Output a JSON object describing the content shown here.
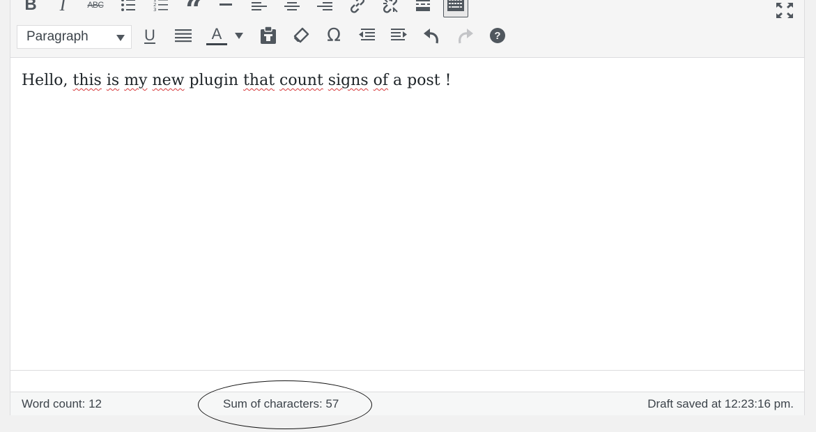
{
  "toolbar": {
    "row1": [
      {
        "name": "bold-button",
        "icon": "bold-icon",
        "glyph": "B"
      },
      {
        "name": "italic-button",
        "icon": "italic-icon",
        "glyph": "I"
      },
      {
        "name": "strikethrough-button",
        "icon": "strikethrough-icon",
        "glyph": "ABC"
      },
      {
        "name": "bulleted-list-button",
        "icon": "bulleted-list-icon"
      },
      {
        "name": "numbered-list-button",
        "icon": "numbered-list-icon"
      },
      {
        "name": "blockquote-button",
        "icon": "blockquote-icon",
        "glyph": "“"
      },
      {
        "name": "horizontal-line-button",
        "icon": "horizontal-line-icon"
      },
      {
        "name": "align-left-button",
        "icon": "align-left-icon"
      },
      {
        "name": "align-center-button",
        "icon": "align-center-icon"
      },
      {
        "name": "align-right-button",
        "icon": "align-right-icon"
      },
      {
        "name": "insert-link-button",
        "icon": "link-icon"
      },
      {
        "name": "remove-link-button",
        "icon": "unlink-icon"
      },
      {
        "name": "read-more-button",
        "icon": "read-more-icon"
      },
      {
        "name": "toolbar-toggle-button",
        "icon": "keyboard-icon",
        "active": true
      }
    ],
    "row2": {
      "format_select_value": "Paragraph",
      "underline_glyph": "U",
      "text_color_glyph": "A",
      "special_char_glyph": "Ω",
      "help_glyph": "?"
    }
  },
  "editor": {
    "content": [
      "Hello,",
      " ",
      "this",
      " ",
      "is",
      " ",
      "my",
      " ",
      "new",
      " plugin ",
      "that",
      " ",
      "count",
      " ",
      "signs",
      " ",
      "of",
      " a post !"
    ],
    "misspelled": [
      2,
      4,
      6,
      8,
      10,
      12,
      14,
      16
    ]
  },
  "status_bar": {
    "word_count": "Word count: 12",
    "char_count": "Sum of characters: 57",
    "draft_saved": "Draft saved at 12:23:16 pm."
  },
  "colors": {
    "icon": "#50575e",
    "disabled_icon": "#c3c4c7",
    "spellcheck_underline": "#d63638",
    "annotation_ellipse": "#111111"
  }
}
